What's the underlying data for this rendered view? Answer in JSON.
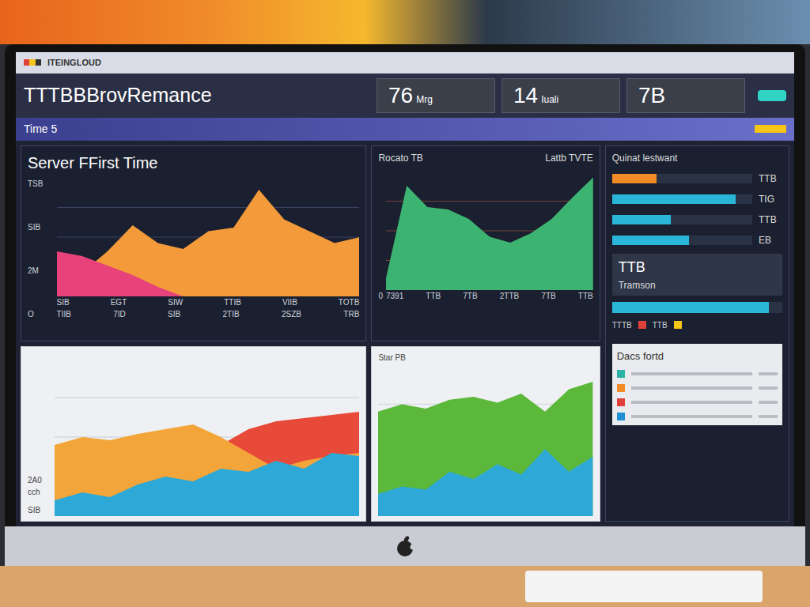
{
  "brand": "ITEINGLOUD",
  "title": "TTTBBBrovRemance",
  "stats": [
    {
      "value": "76",
      "unit": "Mrg"
    },
    {
      "value": "14",
      "unit": "Iuali"
    },
    {
      "value": "7B"
    }
  ],
  "band": {
    "label": "Time 5"
  },
  "left_chart": {
    "title": "Server FFirst Time",
    "y_ticks": [
      "TSB",
      "SIB",
      "2M",
      "O"
    ],
    "x_ticks": [
      "SIB",
      "EGT",
      "SIW",
      "TTIB",
      "VIIB",
      "TOTB"
    ],
    "x_ticks_2": [
      "TIIB",
      "7ID",
      "SIB",
      "2TIB",
      "2SZB",
      "TRB"
    ],
    "series": [
      {
        "values": [
          5,
          20,
          38,
          60,
          45,
          40,
          55,
          58,
          90,
          65,
          55,
          45,
          50
        ],
        "color": "#f39a3a"
      },
      {
        "values": [
          38,
          34,
          26,
          18,
          8,
          0,
          0,
          0,
          0,
          0,
          0,
          0,
          0
        ],
        "color": "#e8427a"
      }
    ]
  },
  "mid_chart": {
    "title": "Rocato TB",
    "subtitle": "Lattb TVTE",
    "y_ticks": [
      "0"
    ],
    "x_ticks": [
      "7391",
      "TTB",
      "7TB",
      "2TTB",
      "7TB",
      "TTB"
    ],
    "series": [
      {
        "values": [
          10,
          88,
          70,
          68,
          60,
          45,
          40,
          48,
          60,
          78,
          95
        ],
        "color": "#3cb371"
      }
    ]
  },
  "side": {
    "title": "Quinat lestwant",
    "bars": [
      {
        "label": "TTB",
        "level": 0.32,
        "color": "#f28c28"
      },
      {
        "label": "TIG",
        "level": 0.88,
        "color": "#29b6d9"
      },
      {
        "label": "TTB",
        "level": 0.42,
        "color": "#29b6d9"
      },
      {
        "label": "EB",
        "level": 0.55,
        "color": "#29b6d9"
      }
    ],
    "summary": {
      "label": "TTB",
      "sub": "Tramson",
      "level": 0.92
    },
    "mini_row": [
      "TTTB",
      "TTB"
    ],
    "list": {
      "title": "Dacs fortd",
      "items": [
        {
          "color": "#2bb3a8"
        },
        {
          "color": "#f28c28"
        },
        {
          "color": "#e0403a"
        },
        {
          "color": "#1f8fd6"
        }
      ]
    }
  },
  "bottom_left": {
    "labels": [
      "2A0 cch",
      "SIB"
    ],
    "series": [
      {
        "values": [
          30,
          32,
          35,
          38,
          40,
          42,
          45,
          55,
          60,
          62,
          64,
          66
        ],
        "color": "#e84a3a"
      },
      {
        "values": [
          45,
          50,
          48,
          52,
          55,
          58,
          50,
          40,
          30,
          35,
          38,
          40
        ],
        "color": "#f3a53a"
      },
      {
        "values": [
          10,
          15,
          12,
          20,
          25,
          22,
          30,
          28,
          35,
          30,
          40,
          38
        ],
        "color": "#2ea8d6"
      }
    ]
  },
  "bottom_mid": {
    "label": "Star PB",
    "series": [
      {
        "values": [
          70,
          75,
          72,
          78,
          80,
          76,
          82,
          70,
          85,
          90
        ],
        "color": "#5cb83a"
      },
      {
        "values": [
          15,
          20,
          18,
          30,
          25,
          35,
          28,
          45,
          30,
          40
        ],
        "color": "#2ea8d6"
      }
    ]
  }
}
